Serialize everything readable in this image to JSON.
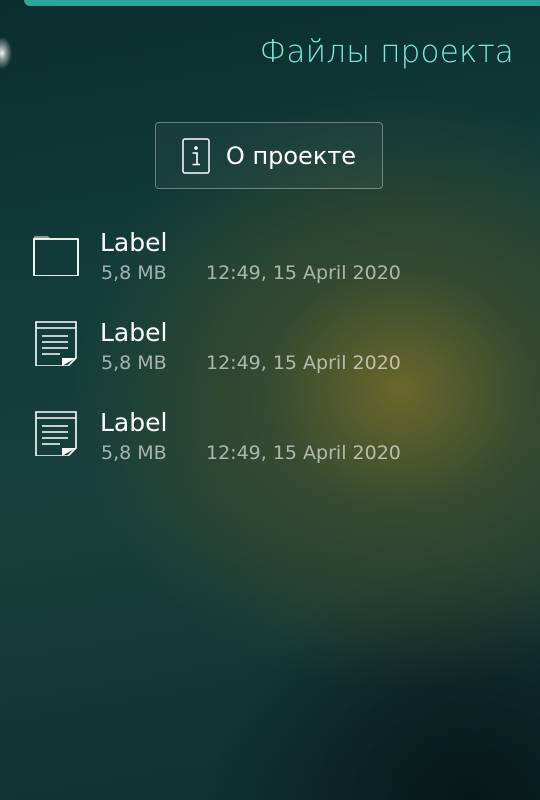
{
  "header": {
    "title": "Файлы проекта"
  },
  "about_button": {
    "icon": "info-icon",
    "label": "О проекте"
  },
  "files": [
    {
      "icon": "folder-icon",
      "name": "Label",
      "size": "5,8 MB",
      "modified": "12:49, 15 April 2020"
    },
    {
      "icon": "document-icon",
      "name": "Label",
      "size": "5,8 MB",
      "modified": "12:49, 15 April 2020"
    },
    {
      "icon": "document-icon",
      "name": "Label",
      "size": "5,8 MB",
      "modified": "12:49, 15 April 2020"
    }
  ],
  "colors": {
    "accent": "#2aa79b",
    "title": "#7ae7dc",
    "background": "#123c3a"
  }
}
